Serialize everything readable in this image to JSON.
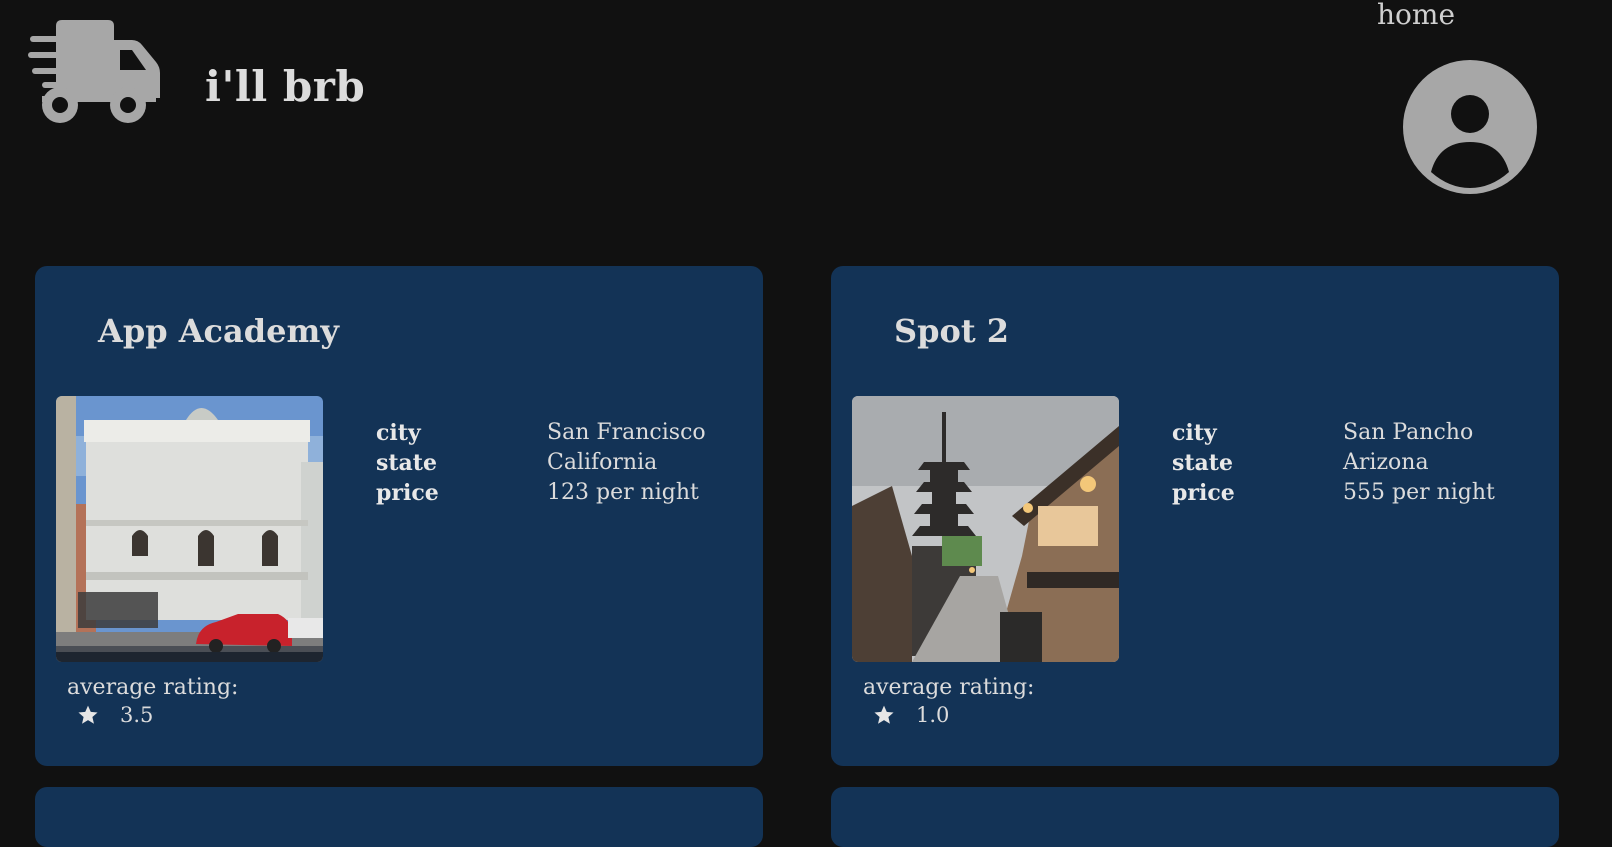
{
  "header": {
    "title": "i'll brb",
    "home_label": "home",
    "logo_icon": "truck-fast-icon",
    "avatar_icon": "user-circle-icon"
  },
  "colors": {
    "background": "#111111",
    "card": "#133356",
    "icon_gray": "#a7a7a7",
    "text": "#dcdcdc"
  },
  "spots": [
    {
      "name": "App Academy",
      "city_label": "city",
      "city": "San Francisco",
      "state_label": "state",
      "state": "California",
      "price_label": "price",
      "price": "123 per night",
      "rating_label": "average rating:",
      "rating": "3.5",
      "image": "classical-building-photo"
    },
    {
      "name": "Spot 2",
      "city_label": "city",
      "city": "San Pancho",
      "state_label": "state",
      "state": "Arizona",
      "price_label": "price",
      "price": "555 per night",
      "rating_label": "average rating:",
      "rating": "1.0",
      "image": "kyoto-pagoda-street-photo"
    }
  ]
}
